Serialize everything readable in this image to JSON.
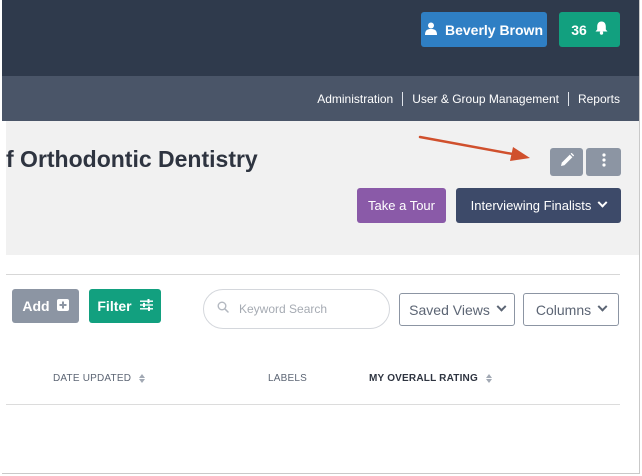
{
  "header": {
    "user_name": "Beverly Brown",
    "notification_count": "36"
  },
  "nav": {
    "items": [
      "Administration",
      "User & Group Management",
      "Reports"
    ]
  },
  "page": {
    "title": "f Orthodontic Dentistry",
    "tour_label": "Take a Tour",
    "stage_label": "Interviewing Finalists"
  },
  "toolbar": {
    "add_label": "Add",
    "filter_label": "Filter",
    "search_placeholder": "Keyword Search",
    "saved_views_label": "Saved Views",
    "columns_label": "Columns"
  },
  "table": {
    "headers": [
      "DATE UPDATED",
      "LABELS",
      "MY OVERALL RATING"
    ]
  },
  "icons": {
    "user": "user-icon",
    "bell": "bell-icon",
    "edit": "pencil-icon",
    "more": "vertical-dots-icon",
    "add": "plus-square-icon",
    "filter": "sliders-icon",
    "search": "search-icon",
    "dropdown": "chevron-down-icon",
    "sort": "sort-icon",
    "annotation": "red-arrow"
  },
  "colors": {
    "topbar": "#2f3a4c",
    "subnav": "#4a5568",
    "user_button": "#2f7fc4",
    "teal": "#12a07f",
    "purple": "#8a5aa8",
    "navy": "#3d4a69",
    "gray_button": "#8c95a3",
    "arrow": "#d0502d"
  }
}
